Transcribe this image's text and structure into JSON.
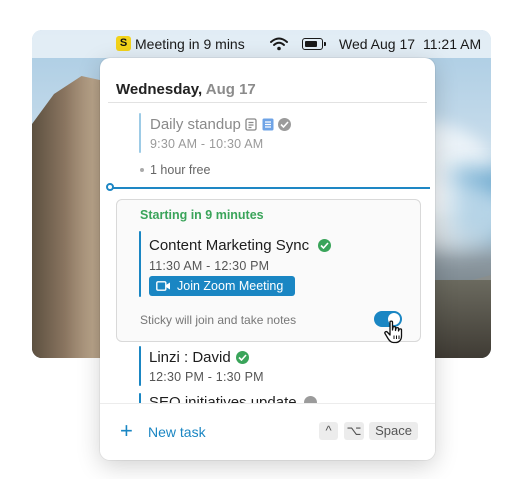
{
  "menubar": {
    "app_badge": "S",
    "meeting_status": "Meeting in 9 mins",
    "date": "Wed Aug 17",
    "time": "11:21 AM",
    "icons": [
      "wifi-icon",
      "battery-icon"
    ]
  },
  "panel": {
    "weekday": "Wednesday,",
    "date": "Aug 17",
    "events_before": [
      {
        "title": "Daily standup",
        "time": "9:30 AM - 10:30 AM",
        "icons": [
          "notes-icon",
          "doc-icon",
          "check-icon"
        ]
      }
    ],
    "free_time": "1 hour free",
    "upcoming": {
      "heading": "Starting in 9 minutes",
      "title": "Content Marketing Sync",
      "time": "11:30 AM - 12:30 PM",
      "join_label": "Join Zoom Meeting",
      "sticky_label": "Sticky will join and take notes",
      "sticky_enabled": true
    },
    "events_after": [
      {
        "title": "Linzi : David",
        "time": "12:30 PM - 1:30 PM"
      },
      {
        "title": "SEO initiatives update"
      }
    ],
    "footer": {
      "new_task_label": "New task",
      "shortcut_keys": [
        "^",
        "⌥",
        "Space"
      ]
    }
  },
  "colors": {
    "accent": "#1a86c3",
    "success": "#3aa45a"
  }
}
